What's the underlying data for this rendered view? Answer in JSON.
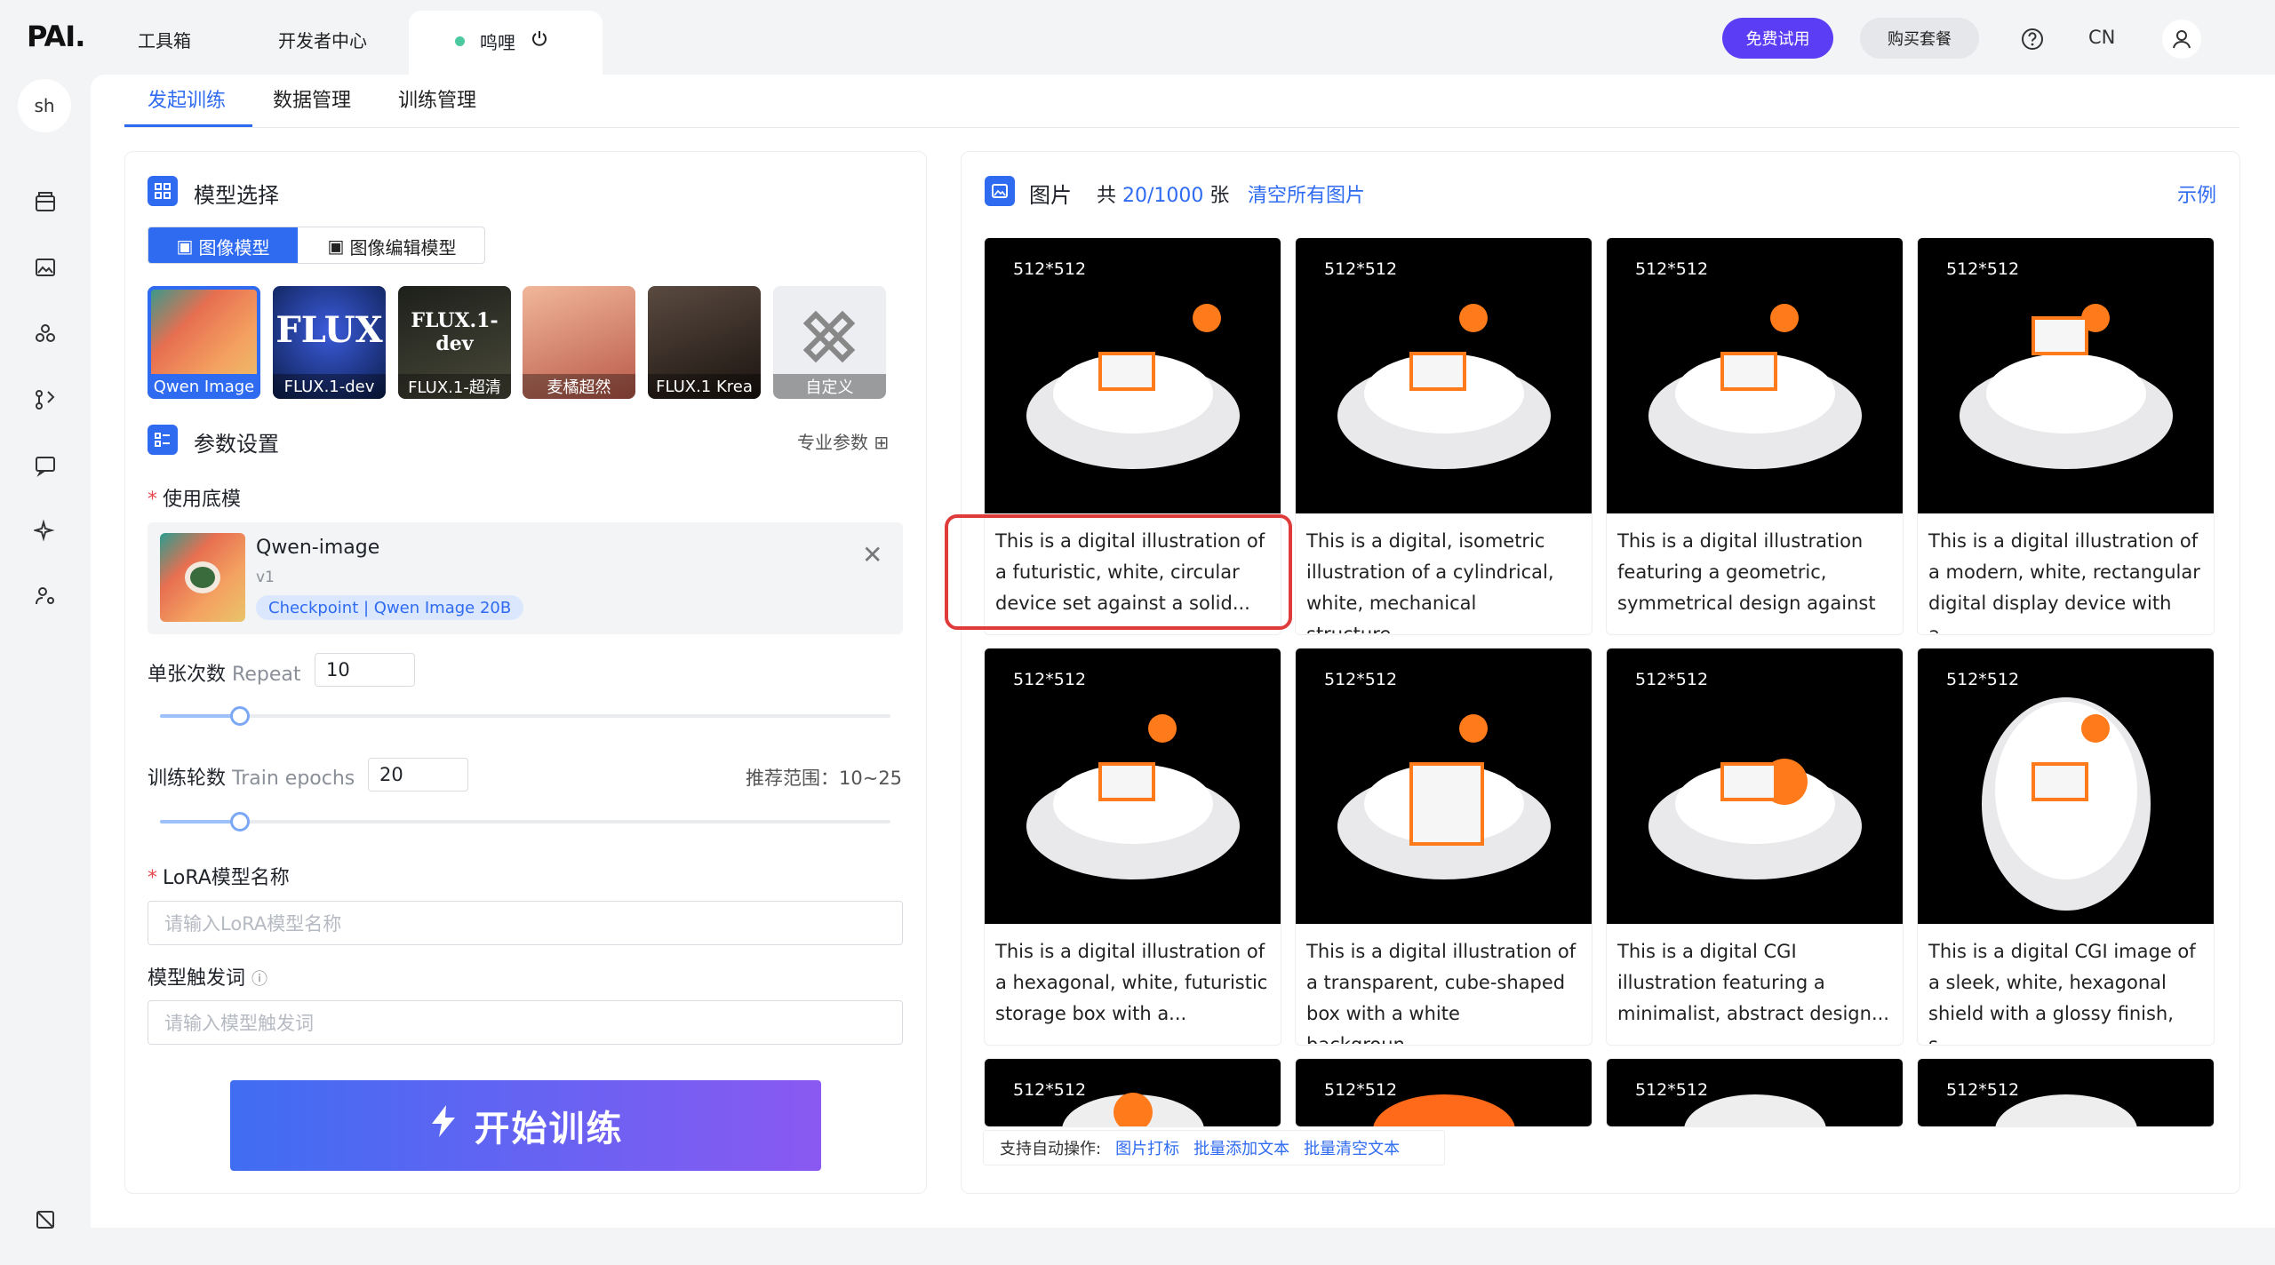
{
  "topbar": {
    "logo": "PAI.",
    "tabs": [
      "工具箱",
      "开发者中心"
    ],
    "active_tab": "鸣哩",
    "free_trial": "免费试用",
    "buy": "购买套餐",
    "lang": "CN"
  },
  "rail": {
    "avatar": "sh"
  },
  "subtabs": [
    "发起训练",
    "数据管理",
    "训练管理"
  ],
  "model_select": {
    "title": "模型选择",
    "toggle": [
      "图像模型",
      "图像编辑模型"
    ],
    "models": [
      {
        "label": "Qwen Image",
        "bg": "linear-gradient(135deg,#2a9d8f,#e76f51,#f4a261,#e9c46a)"
      },
      {
        "label": "FLUX.1-dev",
        "bg": "radial-gradient(circle at 50% 40%,#3b5bdb,#0b1d4a)",
        "art": "FLUX"
      },
      {
        "label": "FLUX.1-超清",
        "bg": "linear-gradient(160deg,#1d1f1a,#4a4a3a)",
        "art": "FLUX.1-dev"
      },
      {
        "label": "麦橘超然",
        "bg": "linear-gradient(160deg,#f1b79a,#b9594a)"
      },
      {
        "label": "FLUX.1 Krea",
        "bg": "linear-gradient(160deg,#5a4a40,#1b1410)"
      },
      {
        "label": "自定义",
        "bg": "#eceef1"
      }
    ]
  },
  "params": {
    "title": "参数设置",
    "pro": "专业参数",
    "base_label": "使用底模",
    "base_name": "Qwen-image",
    "base_ver": "v1",
    "base_tag": "Checkpoint | Qwen Image 20B",
    "repeat_label": "单张次数",
    "repeat_en": "Repeat",
    "repeat_val": "10",
    "repeat_frac": 0.11,
    "epochs_label": "训练轮数",
    "epochs_en": "Train epochs",
    "epochs_val": "20",
    "epochs_frac": 0.11,
    "recommend": "推荐范围：10~25",
    "lora_label": "LoRA模型名称",
    "lora_ph": "请输入LoRA模型名称",
    "trigger_label": "模型触发词",
    "trigger_ph": "请输入模型触发词",
    "start": "开始训练"
  },
  "gallery": {
    "title": "图片",
    "count_prefix": "共",
    "count": "20/1000",
    "count_suffix": "张",
    "clear": "清空所有图片",
    "example": "示例",
    "hint_prefix": "支持自动操作:",
    "hint_links": [
      "图片打标",
      "批量添加文本",
      "批量清空文本"
    ],
    "images": [
      {
        "size": "512*512",
        "caption": "This is a digital illustration of a futuristic, white, circular device set against a solid..."
      },
      {
        "size": "512*512",
        "caption": "This is a digital, isometric illustration of a cylindrical, white, mechanical structure..."
      },
      {
        "size": "512*512",
        "caption": "This is a digital illustration featuring a geometric, symmetrical design against ..."
      },
      {
        "size": "512*512",
        "caption": "This is a digital illustration of a modern, white, rectangular digital display device with a..."
      },
      {
        "size": "512*512",
        "caption": "This is a digital illustration of a hexagonal, white, futuristic storage box with a..."
      },
      {
        "size": "512*512",
        "caption": "This is a digital illustration of a transparent, cube-shaped box with a white backgroun..."
      },
      {
        "size": "512*512",
        "caption": "This is a digital CGI illustration featuring a minimalist, abstract design..."
      },
      {
        "size": "512*512",
        "caption": "This is a digital CGI image of a sleek, white, hexagonal shield with a glossy finish, s..."
      },
      {
        "size": "512*512",
        "caption": ""
      },
      {
        "size": "512*512",
        "caption": ""
      },
      {
        "size": "512*512",
        "caption": ""
      },
      {
        "size": "512*512",
        "caption": ""
      }
    ]
  }
}
